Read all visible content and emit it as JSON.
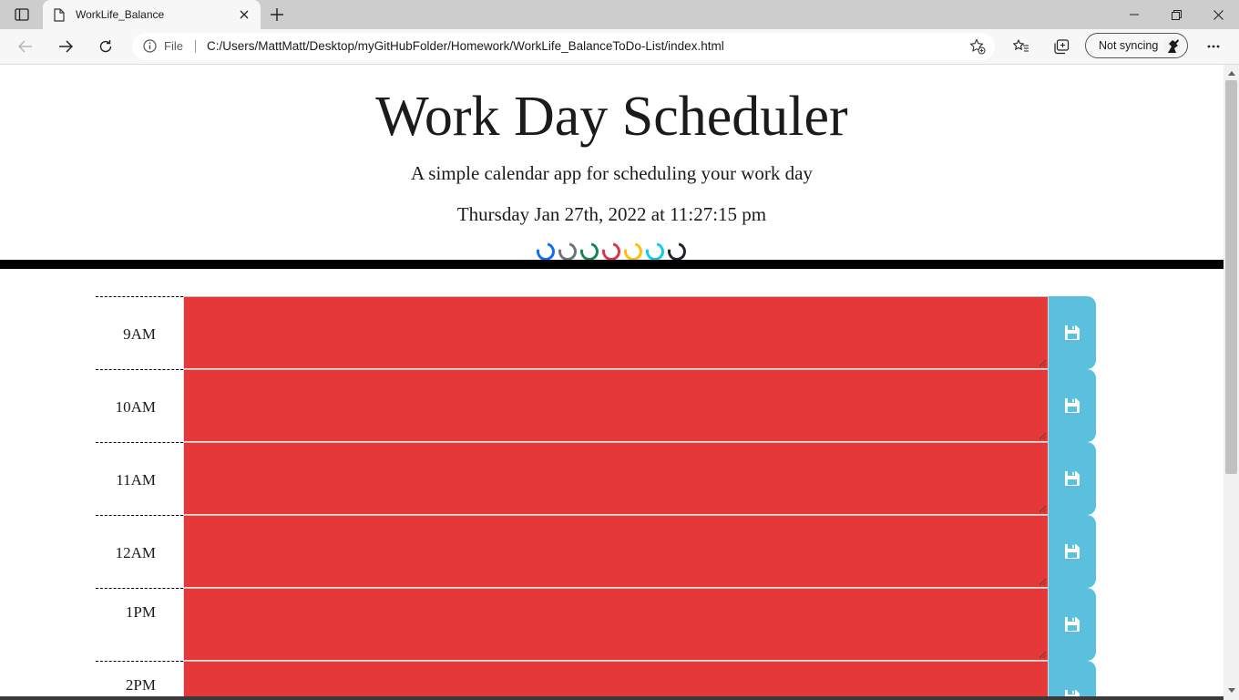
{
  "browser": {
    "tab_title": "WorkLife_Balance",
    "site_info_label": "File",
    "url": "C:/Users/MattMatt/Desktop/myGitHubFolder/Homework/WorkLife_BalanceToDo-List/index.html",
    "profile_label": "Not syncing"
  },
  "header": {
    "title": "Work Day Scheduler",
    "subtitle": "A simple calendar app for scheduling your work day",
    "current_datetime": "Thursday Jan 27th, 2022 at 11:27:15 pm",
    "spinner_colors": [
      "#0d6efd",
      "#6c757d",
      "#198754",
      "#dc3545",
      "#ffc107",
      "#0dcaf0",
      "#212529"
    ]
  },
  "schedule": {
    "row_color": "#e53838",
    "save_color": "#5bc0de",
    "save_icon": "floppy-disk-icon",
    "rows": [
      {
        "hour": "9AM",
        "task": ""
      },
      {
        "hour": "10AM",
        "task": ""
      },
      {
        "hour": "11AM",
        "task": ""
      },
      {
        "hour": "12AM",
        "task": ""
      },
      {
        "hour": "1PM",
        "task": ""
      },
      {
        "hour": "2PM",
        "task": ""
      }
    ]
  }
}
